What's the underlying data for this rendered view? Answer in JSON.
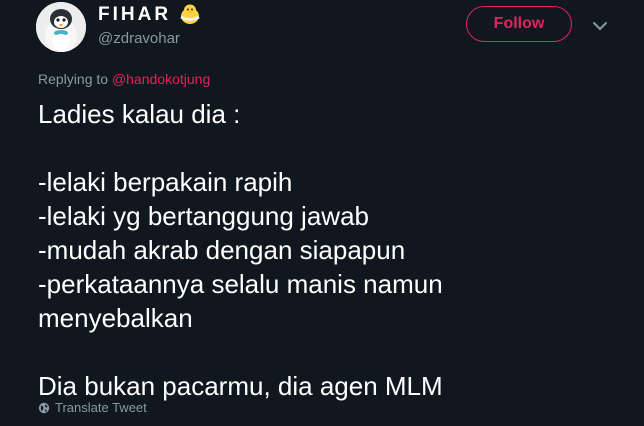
{
  "author": {
    "display_name": "FIHAR",
    "name_emoji_icon": "baby-chick-icon",
    "handle": "@zdravohar",
    "avatar_icon": "penguin-avatar-icon"
  },
  "actions": {
    "follow_label": "Follow",
    "caret_icon": "chevron-down-icon"
  },
  "reply": {
    "prefix": "Replying to",
    "mention": "@handokotjung"
  },
  "tweet": {
    "text": "Ladies kalau dia :\n\n-lelaki berpakain rapih\n-lelaki yg bertanggung jawab\n-mudah akrab dengan siapapun\n-perkataannya selalu manis namun\nmenyebalkan\n\nDia bukan pacarmu, dia agen MLM"
  },
  "footer": {
    "translate_label": "Translate Tweet",
    "globe_icon": "globe-icon"
  },
  "colors": {
    "background": "#10171e",
    "accent": "#e0245e",
    "muted": "#8899a6",
    "text": "#ffffff"
  }
}
